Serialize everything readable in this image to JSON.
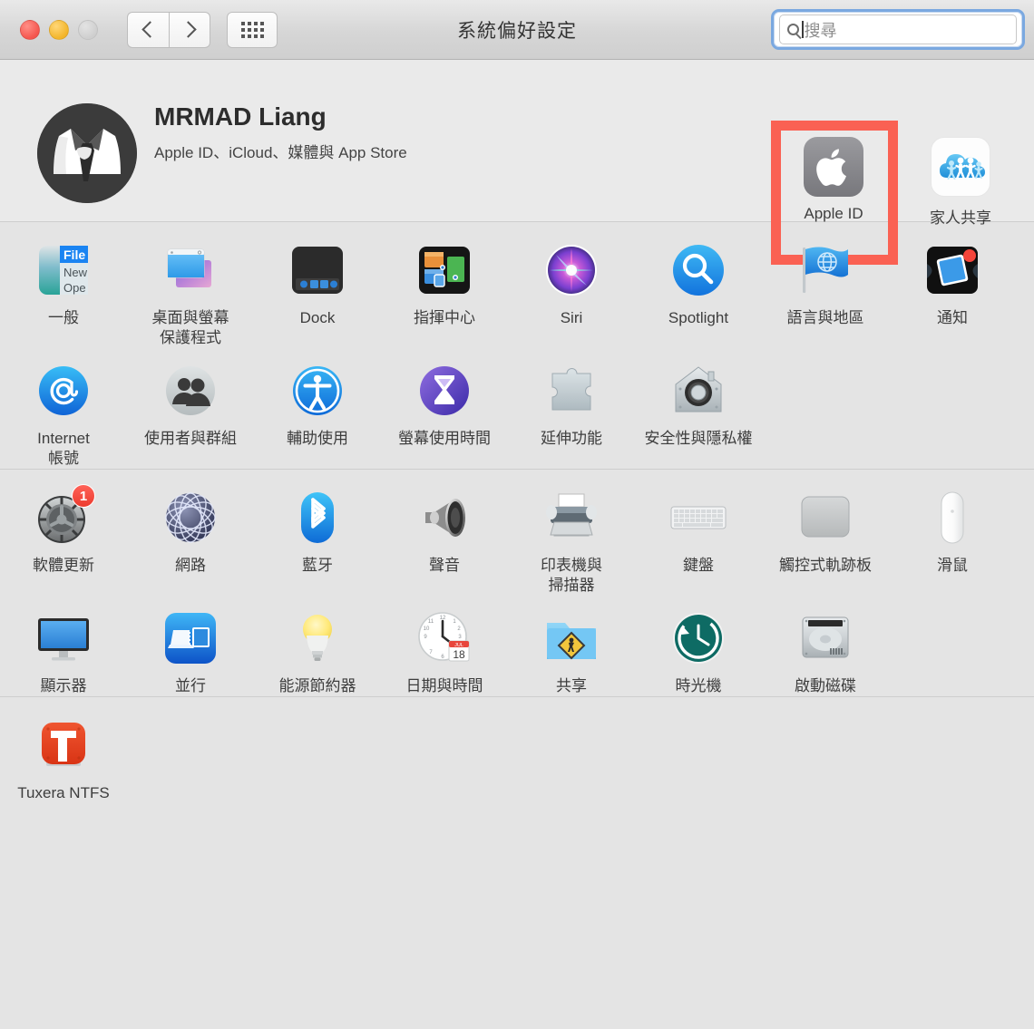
{
  "window": {
    "title": "系統偏好設定",
    "traffic_lights": [
      "close-red",
      "minimize-yellow",
      "zoom-disabled"
    ],
    "nav": {
      "back": "back-chevron",
      "forward": "forward-chevron",
      "grid": "show-all-grid"
    }
  },
  "search": {
    "placeholder": "搜尋",
    "value": "",
    "icon": "search-icon",
    "focused": true
  },
  "account": {
    "avatar": "user-avatar-suit-silhouette",
    "name": "MRMAD Liang",
    "subtitle": "Apple ID、iCloud、媒體與 App Store",
    "buttons": [
      {
        "id": "apple-id",
        "label": "Apple ID",
        "icon": "apple-logo-icon",
        "highlighted": true
      },
      {
        "id": "family-sharing",
        "label": "家人共享",
        "icon": "family-sharing-cloud-icon",
        "highlighted": false
      }
    ],
    "highlight_color": "#fa6153"
  },
  "sections": [
    {
      "id": "personal",
      "rows": [
        [
          {
            "id": "general",
            "label": "一般",
            "icon": "general-menu-icon"
          },
          {
            "id": "desktop-saver",
            "label": "桌面與螢幕\n保護程式",
            "icon": "desktop-screensaver-icon"
          },
          {
            "id": "dock",
            "label": "Dock",
            "icon": "dock-icon"
          },
          {
            "id": "mission-control",
            "label": "指揮中心",
            "icon": "mission-control-icon"
          },
          {
            "id": "siri",
            "label": "Siri",
            "icon": "siri-icon"
          },
          {
            "id": "spotlight",
            "label": "Spotlight",
            "icon": "spotlight-magnifier-icon"
          },
          {
            "id": "language-region",
            "label": "語言與地區",
            "icon": "language-flag-globe-icon"
          },
          {
            "id": "notifications",
            "label": "通知",
            "icon": "notifications-icon"
          }
        ],
        [
          {
            "id": "internet-accounts",
            "label": "Internet\n帳號",
            "icon": "internet-accounts-at-icon"
          },
          {
            "id": "users-groups",
            "label": "使用者與群組",
            "icon": "users-groups-icon"
          },
          {
            "id": "accessibility",
            "label": "輔助使用",
            "icon": "accessibility-icon"
          },
          {
            "id": "screen-time",
            "label": "螢幕使用時間",
            "icon": "screen-time-hourglass-icon"
          },
          {
            "id": "extensions",
            "label": "延伸功能",
            "icon": "extensions-puzzle-icon"
          },
          {
            "id": "security-privacy",
            "label": "安全性與隱私權",
            "icon": "security-privacy-house-icon"
          }
        ]
      ]
    },
    {
      "id": "hardware",
      "rows": [
        [
          {
            "id": "software-update",
            "label": "軟體更新",
            "icon": "software-update-gear-icon",
            "badge": "1"
          },
          {
            "id": "network",
            "label": "網路",
            "icon": "network-globe-icon"
          },
          {
            "id": "bluetooth",
            "label": "藍牙",
            "icon": "bluetooth-icon"
          },
          {
            "id": "sound",
            "label": "聲音",
            "icon": "sound-speaker-icon"
          },
          {
            "id": "printers",
            "label": "印表機與\n掃描器",
            "icon": "printers-scanners-icon"
          },
          {
            "id": "keyboard",
            "label": "鍵盤",
            "icon": "keyboard-icon"
          },
          {
            "id": "trackpad",
            "label": "觸控式軌跡板",
            "icon": "trackpad-icon"
          },
          {
            "id": "mouse",
            "label": "滑鼠",
            "icon": "mouse-icon"
          }
        ],
        [
          {
            "id": "displays",
            "label": "顯示器",
            "icon": "display-monitor-icon"
          },
          {
            "id": "sidecar",
            "label": "並行",
            "icon": "sidecar-icon"
          },
          {
            "id": "energy-saver",
            "label": "能源節約器",
            "icon": "energy-saver-bulb-icon"
          },
          {
            "id": "date-time",
            "label": "日期與時間",
            "icon": "date-time-clock-icon",
            "calendar_month": "JUL",
            "calendar_day": "18"
          },
          {
            "id": "sharing",
            "label": "共享",
            "icon": "sharing-folder-icon"
          },
          {
            "id": "time-machine",
            "label": "時光機",
            "icon": "time-machine-icon"
          },
          {
            "id": "startup-disk",
            "label": "啟動磁碟",
            "icon": "startup-disk-icon"
          }
        ]
      ]
    },
    {
      "id": "third-party",
      "rows": [
        [
          {
            "id": "tuxera-ntfs",
            "label": "Tuxera NTFS",
            "icon": "tuxera-ntfs-icon",
            "icon_letter": "T"
          }
        ]
      ]
    }
  ]
}
